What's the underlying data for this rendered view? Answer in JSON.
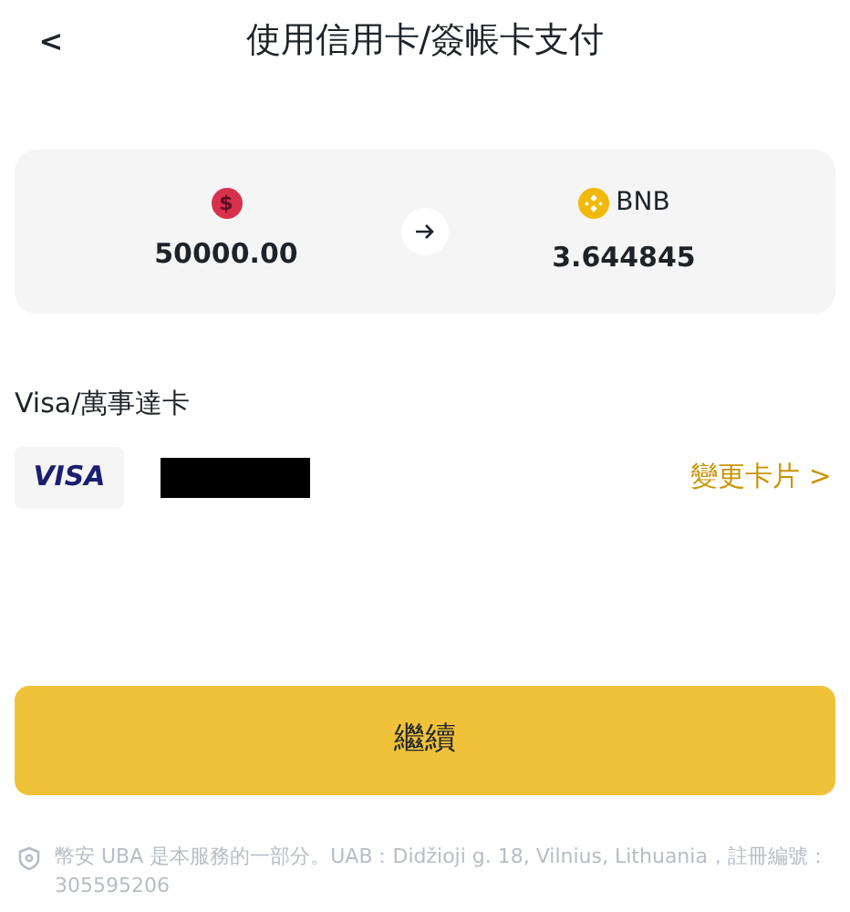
{
  "header": {
    "back": "<",
    "title": "使用信用卡/簽帳卡支付"
  },
  "conversion": {
    "from": {
      "icon": "$",
      "amount": "50000.00"
    },
    "to": {
      "currency": "BNB",
      "amount": "3.644845"
    }
  },
  "payment_method": {
    "label": "Visa/萬事達卡",
    "logo": "VISA",
    "change": "變更卡片 >"
  },
  "continue_button": "繼續",
  "footer": "幣安 UBA 是本服務的一部分。UAB：Didžioji g. 18, Vilnius, Lithuania，註冊編號： 305595206"
}
